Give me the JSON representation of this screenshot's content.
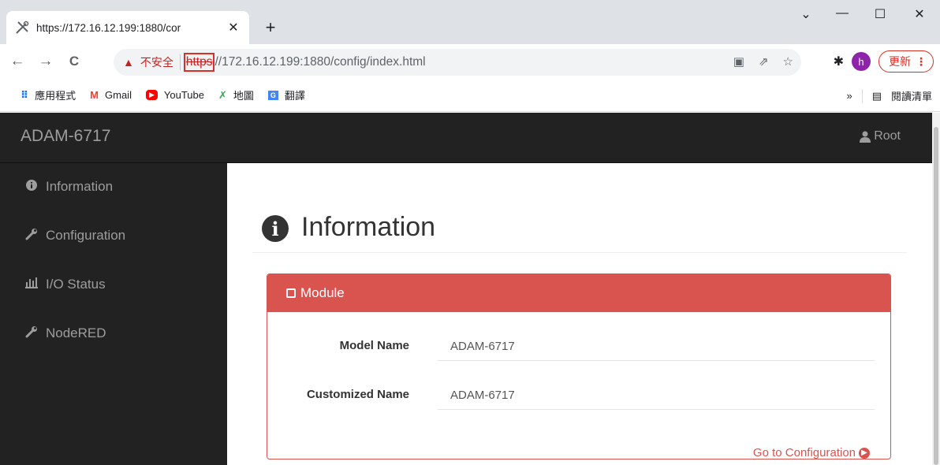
{
  "browser": {
    "tab_title": "https://172.16.12.199:1880/cor",
    "tab_close": "✕",
    "new_tab": "+",
    "win_minimize": "—",
    "win_maximize": "☐",
    "win_close": "✕",
    "win_dropdown": "⌄",
    "nav_back": "←",
    "nav_forward": "→",
    "nav_reload": "C",
    "security_warning": "不安全",
    "url_scheme": "https",
    "url_rest": "//172.16.12.199:1880/config/index.html",
    "profile_initial": "h",
    "update_label": "更新",
    "update_menu": "⋮",
    "bookmarks": [
      {
        "label": "應用程式",
        "icon": "apps-icon"
      },
      {
        "label": "Gmail",
        "icon": "gmail-icon"
      },
      {
        "label": "YouTube",
        "icon": "youtube-icon"
      },
      {
        "label": "地圖",
        "icon": "maps-icon"
      },
      {
        "label": "翻譯",
        "icon": "translate-icon"
      }
    ],
    "bookmarks_more": "»",
    "reading_list": "閱讀清單"
  },
  "app": {
    "brand": "ADAM-6717",
    "user": "Root",
    "sidebar": [
      {
        "label": "Information",
        "icon": "info-circle-icon"
      },
      {
        "label": "Configuration",
        "icon": "wrench-icon"
      },
      {
        "label": "I/O Status",
        "icon": "bar-chart-icon"
      },
      {
        "label": "NodeRED",
        "icon": "wrench-icon"
      }
    ],
    "page_title": "Information",
    "panel": {
      "title": "Module",
      "fields": [
        {
          "label": "Model Name",
          "value": "ADAM-6717"
        },
        {
          "label": "Customized Name",
          "value": "ADAM-6717"
        }
      ],
      "link": "Go to Configuration"
    }
  },
  "colors": {
    "navbar": "#222222",
    "panel_accent": "#d9534f",
    "warning": "#c5221f"
  }
}
